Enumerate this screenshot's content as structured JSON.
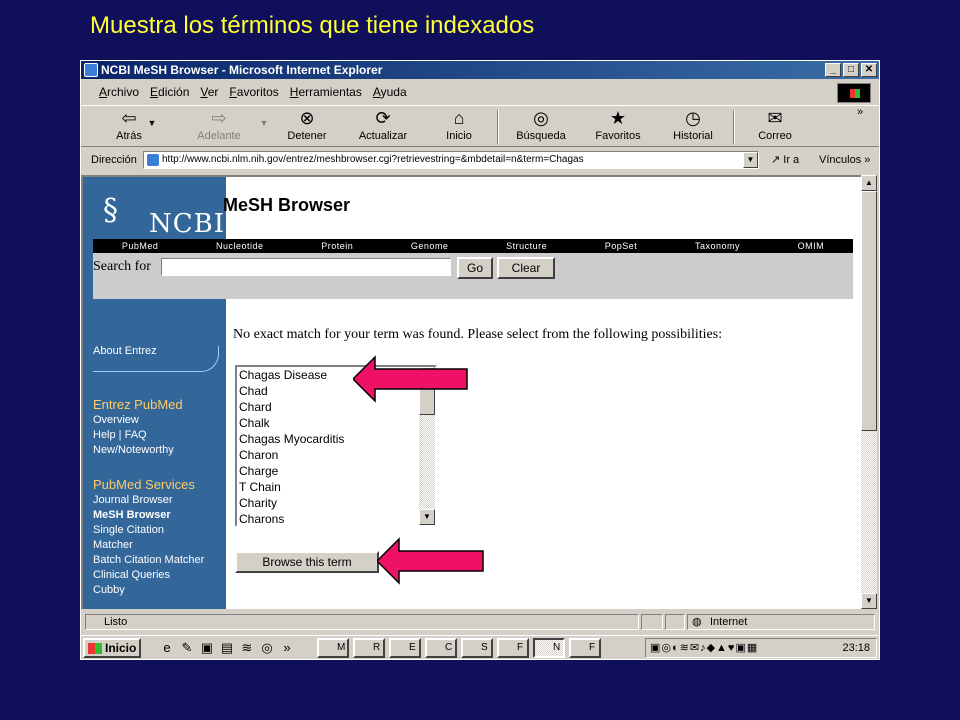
{
  "slide": {
    "title": "Muestra los términos que tiene indexados"
  },
  "window": {
    "title": "NCBI MeSH Browser - Microsoft Internet Explorer",
    "controls": {
      "minimize": "_",
      "maximize": "□",
      "close": "✕"
    }
  },
  "menu": [
    "Archivo",
    "Edición",
    "Ver",
    "Favoritos",
    "Herramientas",
    "Ayuda"
  ],
  "toolbar": {
    "back": "Atrás",
    "forward": "Adelante",
    "stop": "Detener",
    "refresh": "Actualizar",
    "home": "Inicio",
    "search": "Búsqueda",
    "favorites": "Favoritos",
    "history": "Historial",
    "mail": "Correo",
    "more": "»"
  },
  "address": {
    "label": "Dirección",
    "url": "http://www.ncbi.nlm.nih.gov/entrez/meshbrowser.cgi?retrievestring=&mbdetail=n&term=Chagas",
    "go": "Ir a",
    "links": "Vínculos"
  },
  "page": {
    "logo_text": "NCBI",
    "title": "MeSH Browser",
    "nav": [
      "PubMed",
      "Nucleotide",
      "Protein",
      "Genome",
      "Structure",
      "PopSet",
      "Taxonomy",
      "OMIM"
    ],
    "search_label": "Search for",
    "search_value": "",
    "go_button": "Go",
    "clear_button": "Clear",
    "message": "No exact match for your term was found. Please select from the following possibilities:",
    "terms": [
      "Chagas Disease",
      "Chad",
      "Chard",
      "Chalk",
      "Chagas Myocarditis",
      "Charon",
      "Charge",
      "T Chain",
      "Charity",
      "Charons"
    ],
    "browse_button": "Browse this term"
  },
  "sidebar": {
    "about": "About Entrez",
    "pubmed_heading": "Entrez PubMed",
    "pubmed_links": [
      "Overview",
      "Help | FAQ",
      "New/Noteworthy"
    ],
    "services_heading": "PubMed Services",
    "services_links": [
      "Journal Browser",
      "MeSH Browser",
      "Single Citation",
      "Matcher",
      "Batch Citation Matcher",
      "Clinical Queries",
      "Cubby"
    ]
  },
  "status": {
    "text": "Listo",
    "zone": "Internet"
  },
  "taskbar": {
    "start": "Inicio",
    "tasks": [
      "M",
      "R",
      "E",
      "C",
      "S",
      "F",
      "N",
      "F"
    ],
    "clock": "23:18"
  },
  "colors": {
    "desktop": "#10105a",
    "slide_title": "#ffff33",
    "sidebar": "#336699",
    "arrow": "#ee1166"
  }
}
